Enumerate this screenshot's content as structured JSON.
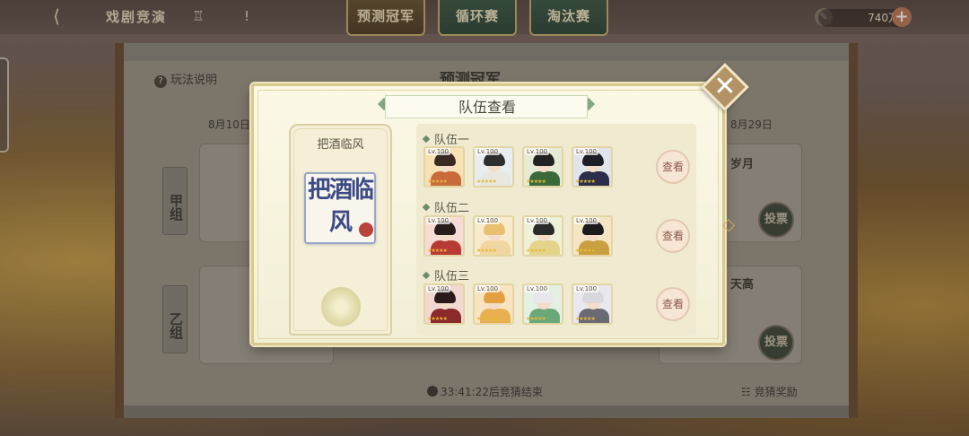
{
  "top_bar": {
    "title": "戏剧竞演",
    "tabs": [
      {
        "label": "预测冠军",
        "active": true
      },
      {
        "label": "循环赛",
        "active": false
      },
      {
        "label": "淘汰赛",
        "active": false
      }
    ],
    "currency_value": "740万",
    "currency_icon": "feather-icon",
    "back_icon": "chevron-left-icon",
    "trophy_icon": "trophy-icon",
    "alert_icon": "exclamation-icon"
  },
  "background_panel": {
    "rules_label": "玩法说明",
    "heading": "预测冠军",
    "date_left": "8月10日",
    "date_right": "8月29日",
    "group_a": "甲组",
    "group_b": "乙组",
    "entry_right_top": "岁月",
    "entry_right_bottom": "天高",
    "vote_label": "投票",
    "countdown": "33:41:22后竞猜结束",
    "reward_label": "竞猜奖励"
  },
  "modal": {
    "title": "队伍查看",
    "close_icon": "close-icon",
    "team_name": "把酒临风",
    "seal_text": "把酒临风",
    "view_label": "查看",
    "teams": [
      {
        "label": "队伍一",
        "members": [
          {
            "level": "Lv.100",
            "hair": "#3a2a24",
            "outfit": "#c86a3a",
            "bg": "#f6e2b4"
          },
          {
            "level": "Lv.100",
            "hair": "#2e2e2e",
            "outfit": "#e8e8e0",
            "bg": "#e8eef0"
          },
          {
            "level": "Lv.100",
            "hair": "#222222",
            "outfit": "#3a6a3a",
            "bg": "#e6ecd4"
          },
          {
            "level": "Lv.100",
            "hair": "#1e1e28",
            "outfit": "#2a2e4a",
            "bg": "#e2e4ec"
          }
        ]
      },
      {
        "label": "队伍二",
        "members": [
          {
            "level": "Lv.100",
            "hair": "#2a1e1a",
            "outfit": "#b83a34",
            "bg": "#f6dcd4"
          },
          {
            "level": "Lv.100",
            "hair": "#e8c070",
            "outfit": "#f0d6a0",
            "bg": "#f8eacc"
          },
          {
            "level": "Lv.100",
            "hair": "#2a2a2a",
            "outfit": "#e4d48a",
            "bg": "#eef0d8"
          },
          {
            "level": "Lv.100",
            "hair": "#1c1c1c",
            "outfit": "#c8a040",
            "bg": "#f4e6c4"
          }
        ]
      },
      {
        "label": "队伍三",
        "members": [
          {
            "level": "Lv.100",
            "hair": "#2a1a1a",
            "outfit": "#8a2a2a",
            "bg": "#f2d8d2"
          },
          {
            "level": "Lv.100",
            "hair": "#e4a040",
            "outfit": "#e8b050",
            "bg": "#f8e4c0"
          },
          {
            "level": "Lv.100",
            "hair": "#e8e8e8",
            "outfit": "#6aa87a",
            "bg": "#e4f0e4"
          },
          {
            "level": "Lv.100",
            "hair": "#d8d8dc",
            "outfit": "#6a6a74",
            "bg": "#e8e8ee"
          }
        ]
      }
    ]
  }
}
